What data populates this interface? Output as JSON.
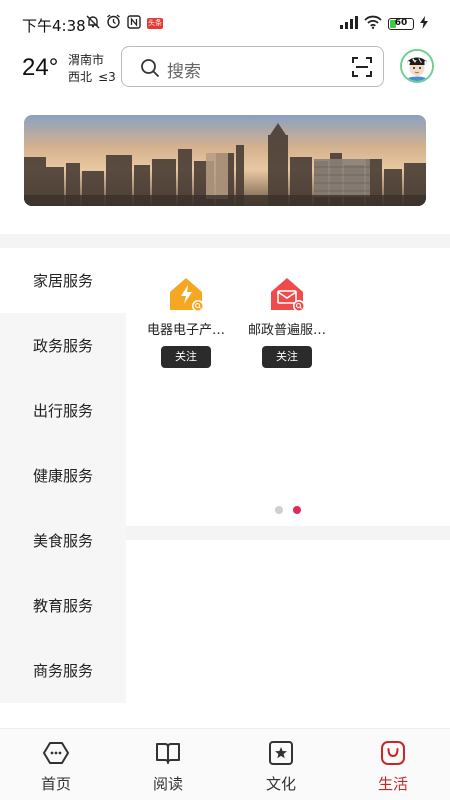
{
  "status_bar": {
    "time": "下午4:38",
    "news_badge": "头条",
    "battery_level": "60",
    "icons": [
      "mute-icon",
      "alarm-icon",
      "nfc-icon",
      "news-badge",
      "signal-icon",
      "wifi-icon",
      "battery-icon",
      "charging-icon"
    ]
  },
  "header": {
    "temperature": "24°",
    "city": "渭南市",
    "wind_direction": "西北",
    "wind_level": "≤3",
    "search_placeholder": "搜索",
    "icons": [
      "search-icon",
      "scan-icon",
      "avatar"
    ]
  },
  "banner": {
    "alt": "city-skyline"
  },
  "categories": [
    {
      "label": "家居服务",
      "active": true
    },
    {
      "label": "政务服务",
      "active": false
    },
    {
      "label": "出行服务",
      "active": false
    },
    {
      "label": "健康服务",
      "active": false
    },
    {
      "label": "美食服务",
      "active": false
    },
    {
      "label": "教育服务",
      "active": false
    },
    {
      "label": "商务服务",
      "active": false
    }
  ],
  "services": [
    {
      "name": "电器电子产…",
      "follow_label": "关注",
      "icon": "house-lightning-icon",
      "color": "#f5a623"
    },
    {
      "name": "邮政普遍服…",
      "follow_label": "关注",
      "icon": "house-mail-icon",
      "color": "#ef4b4b"
    }
  ],
  "pager": {
    "total": 2,
    "active_index": 1,
    "active_color": "#e0285a"
  },
  "bottom_nav": [
    {
      "label": "首页",
      "icon": "home-icon",
      "active": false
    },
    {
      "label": "阅读",
      "icon": "book-icon",
      "active": false
    },
    {
      "label": "文化",
      "icon": "culture-icon",
      "active": false
    },
    {
      "label": "生活",
      "icon": "life-bag-icon",
      "active": true
    }
  ],
  "colors": {
    "accent": "#c62828",
    "pager_active": "#e0285a"
  }
}
